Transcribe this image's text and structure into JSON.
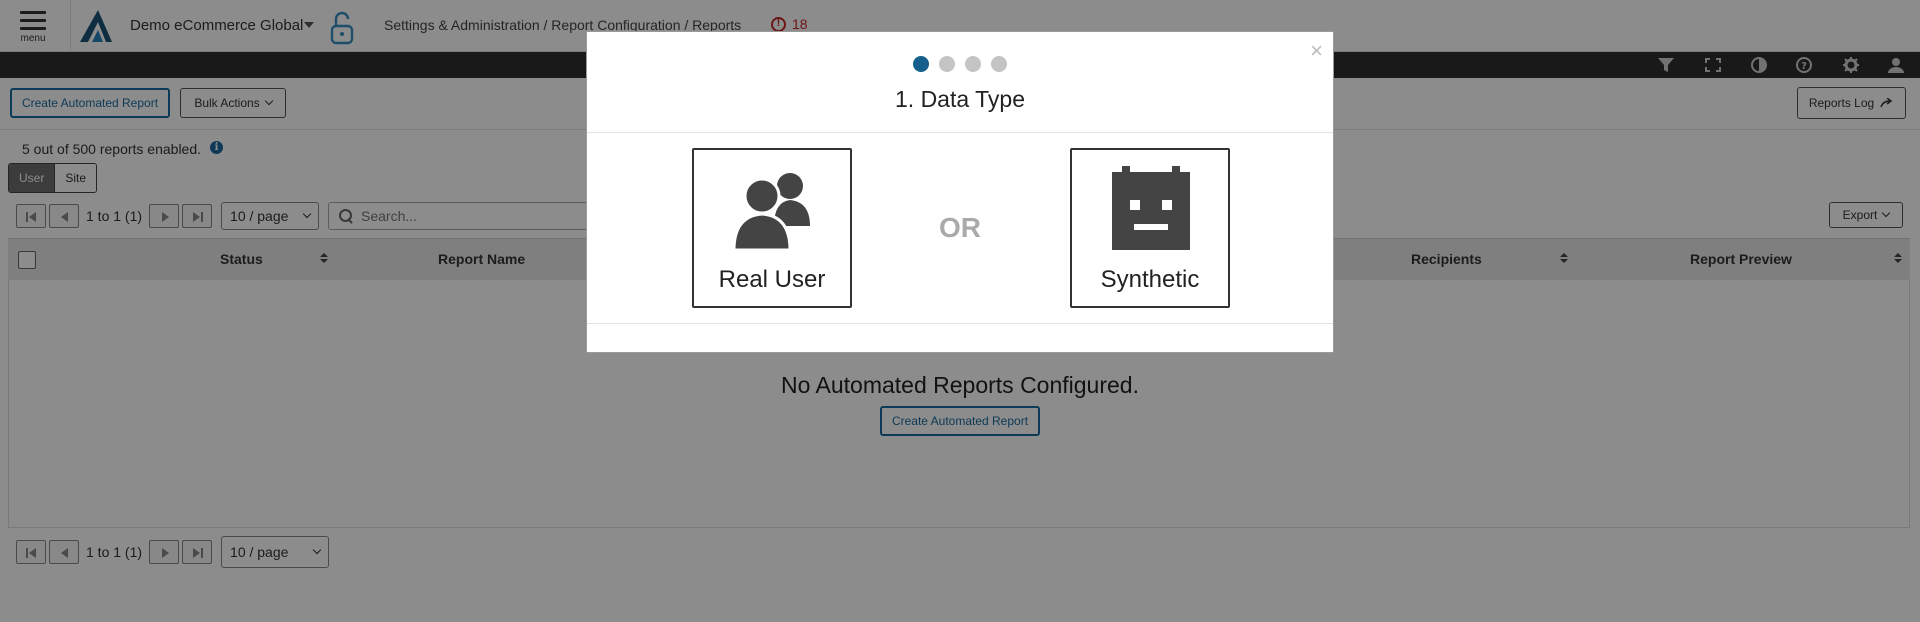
{
  "header": {
    "menu_label": "menu",
    "org_name": "Demo eCommerce Global",
    "breadcrumb": "Settings & Administration / Report Configuration / Reports",
    "alert_count": "18"
  },
  "toolbar": {
    "icons": [
      "filter-icon",
      "fullscreen-icon",
      "contrast-icon",
      "help-icon",
      "settings-icon",
      "user-icon"
    ]
  },
  "actions": {
    "create_label": "Create Automated Report",
    "bulk_label": "Bulk Actions",
    "reports_log_label": "Reports Log"
  },
  "summary": {
    "enabled_text": "5 out of 500 reports enabled.",
    "info_icon": "i"
  },
  "filter": {
    "options": [
      "User",
      "Site"
    ],
    "selected": "User"
  },
  "pagination": {
    "range_text": "1 to 1 (1)",
    "page_size": "10 / page"
  },
  "search": {
    "placeholder": "Search..."
  },
  "export": {
    "label": "Export"
  },
  "table": {
    "columns": [
      "Status",
      "Report Name",
      "Recipients",
      "Report Preview"
    ],
    "empty_message": "No Automated Reports Configured.",
    "empty_action_label": "Create Automated Report"
  },
  "modal": {
    "steps": 4,
    "active_step": 1,
    "title": "1. Data Type",
    "close_glyph": "×",
    "or_text": "OR",
    "options": [
      {
        "label": "Real User",
        "icon": "users-icon"
      },
      {
        "label": "Synthetic",
        "icon": "robot-icon"
      }
    ]
  },
  "colors": {
    "accent": "#155f8a",
    "alert": "#c62828",
    "toolbar": "#2f2f2f"
  }
}
